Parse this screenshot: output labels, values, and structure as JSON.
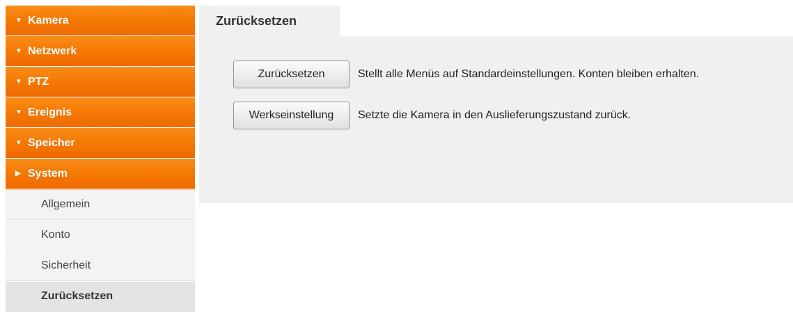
{
  "sidebar": {
    "sections": [
      {
        "label": "Kamera",
        "caret": "▼"
      },
      {
        "label": "Netzwerk",
        "caret": "▼"
      },
      {
        "label": "PTZ",
        "caret": "▼"
      },
      {
        "label": "Ereignis",
        "caret": "▼"
      },
      {
        "label": "Speicher",
        "caret": "▼"
      },
      {
        "label": "System",
        "caret": "▶"
      }
    ],
    "system_items": [
      {
        "label": "Allgemein"
      },
      {
        "label": "Konto"
      },
      {
        "label": "Sicherheit"
      },
      {
        "label": "Zurücksetzen"
      }
    ]
  },
  "main": {
    "tab_title": "Zurücksetzen",
    "reset": {
      "button_label": "Zurücksetzen",
      "description": "Stellt alle Menüs auf Standardeinstellungen. Konten bleiben erhalten."
    },
    "factory": {
      "button_label": "Werkseinstellung",
      "description": "Setzte die Kamera in den Auslieferungszustand zurück."
    }
  },
  "colors": {
    "menu_orange": "#f57a05",
    "panel_gray": "#f0f0f0",
    "active_item": "#e4e4e4"
  }
}
